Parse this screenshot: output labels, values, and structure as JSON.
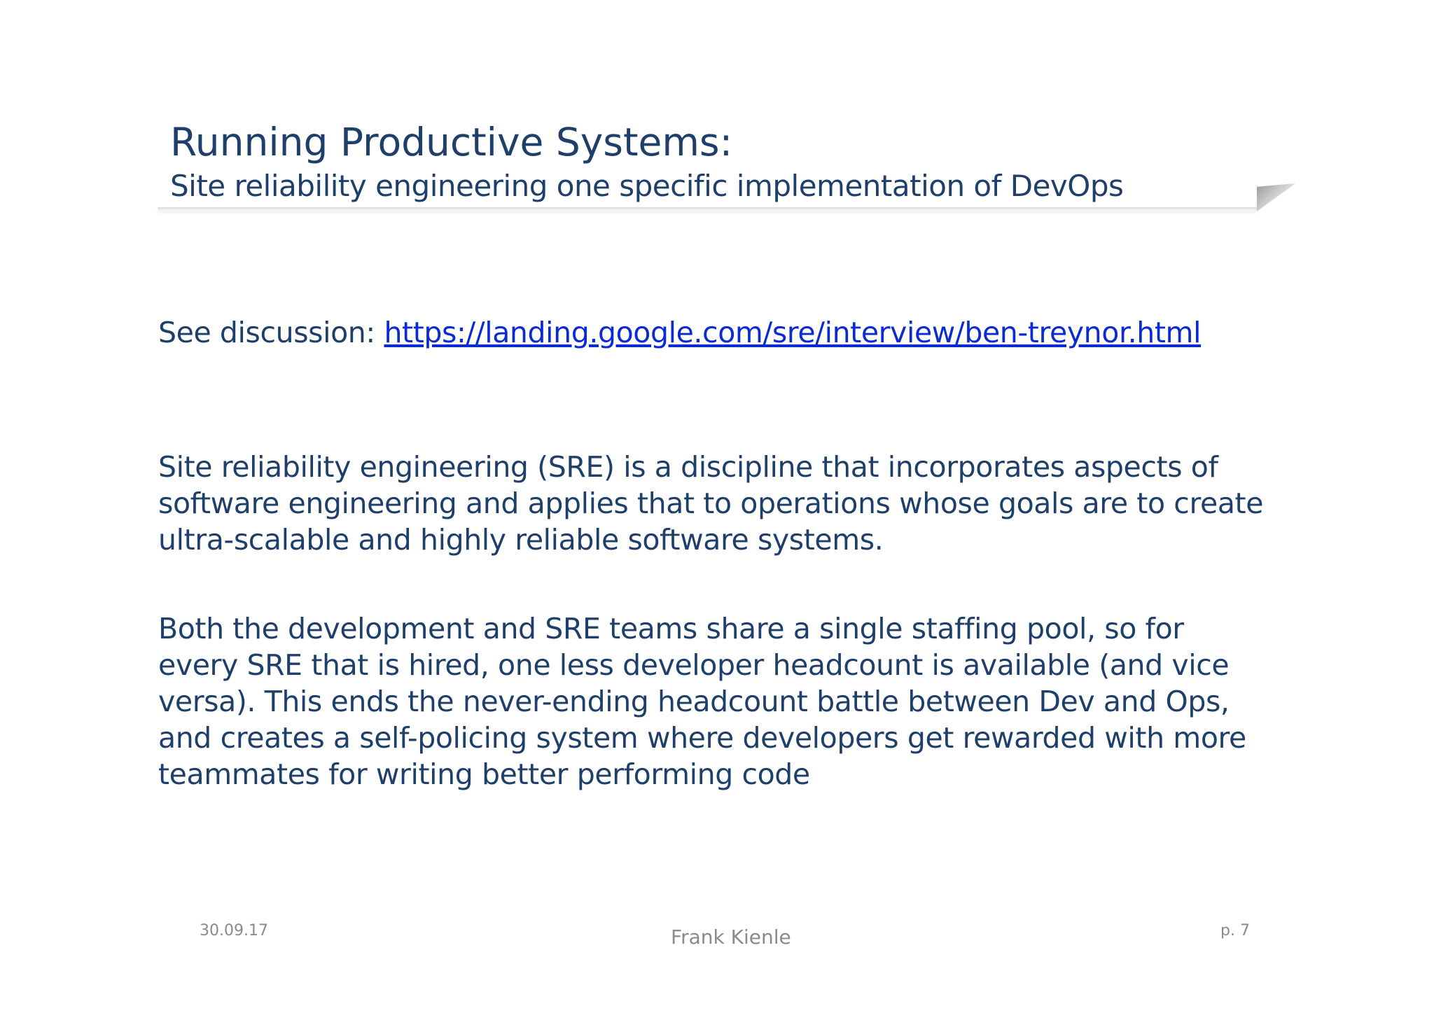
{
  "slide": {
    "title": "Running Productive Systems:",
    "subtitle": "Site reliability engineering one specific implementation of DevOps",
    "discussion_label": "See discussion: ",
    "discussion_link": "https://landing.google.com/sre/interview/ben-treynor.html",
    "paragraphs": [
      "Site reliability engineering (SRE) is a discipline that incorporates aspects of software engineering and applies that to operations whose goals are to create ultra-scalable and highly reliable software systems.",
      "Both the development and SRE teams share a single staffing pool, so for every SRE that is hired, one less developer headcount is available (and vice versa). This ends the never-ending headcount battle between Dev and Ops, and creates a self-policing system where developers get rewarded with more teammates for writing better performing code"
    ]
  },
  "footer": {
    "date": "30.09.17",
    "author": "Frank Kienle",
    "page": "p. 7"
  },
  "colors": {
    "text": "#1f3f6b",
    "link": "#0a2bd4",
    "footer": "#8a8a8a"
  }
}
